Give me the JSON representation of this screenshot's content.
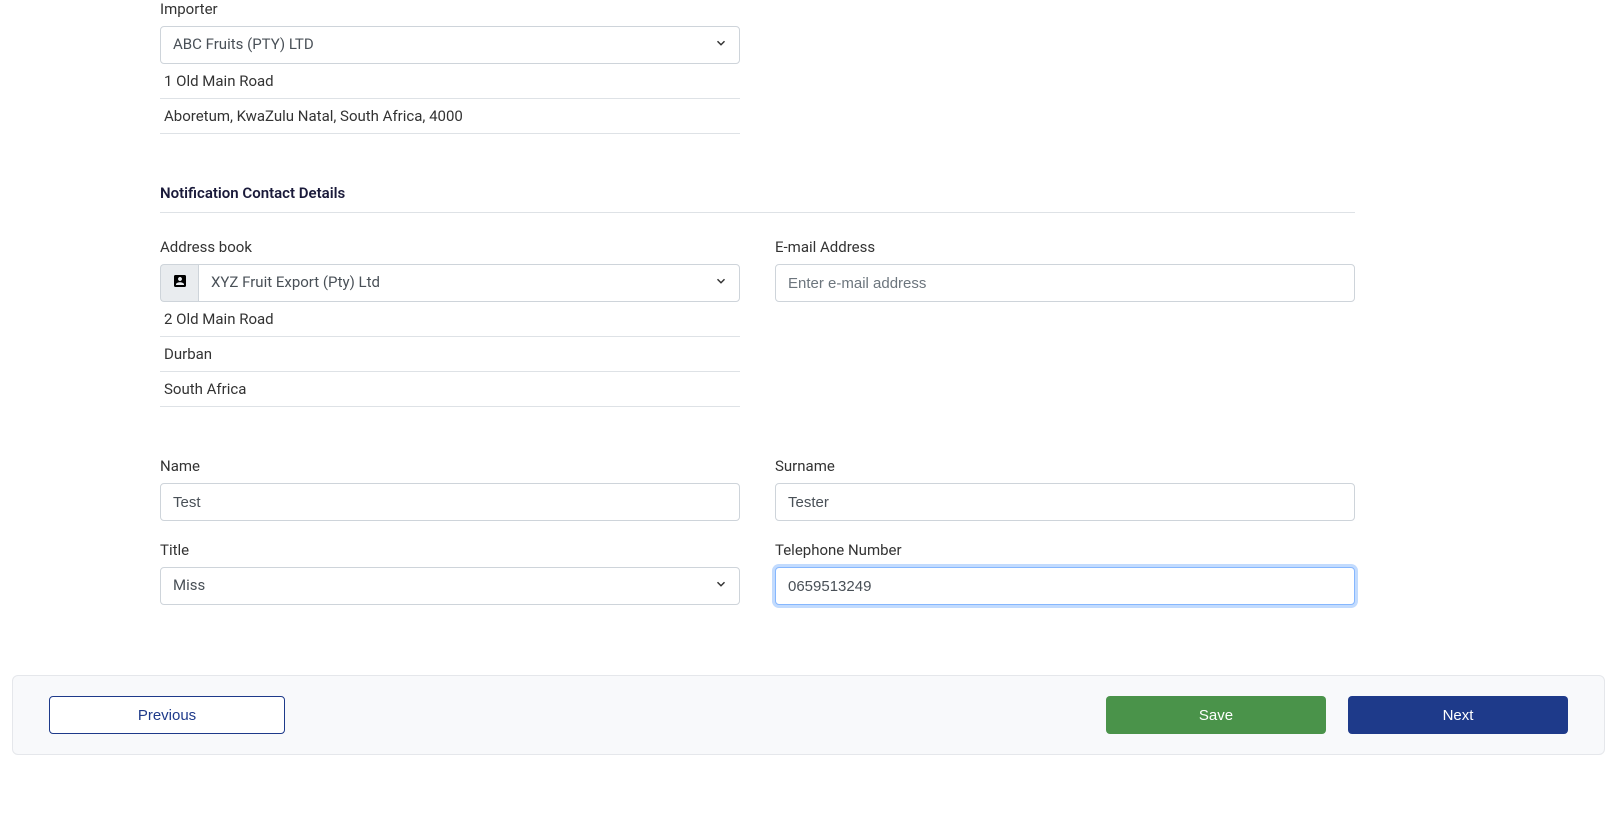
{
  "importer": {
    "label": "Importer",
    "selected": "ABC Fruits (PTY) LTD",
    "address_line1": "1 Old Main Road",
    "address_line2": "Aboretum, KwaZulu Natal, South Africa, 4000"
  },
  "notification": {
    "section_title": "Notification Contact Details",
    "address_book": {
      "label": "Address book",
      "selected": "XYZ Fruit Export (Pty) Ltd",
      "line1": "2 Old Main Road",
      "line2": "Durban",
      "line3": "South Africa"
    },
    "email": {
      "label": "E-mail Address",
      "placeholder": "Enter e-mail address",
      "value": ""
    },
    "name": {
      "label": "Name",
      "value": "Test"
    },
    "surname": {
      "label": "Surname",
      "value": "Tester"
    },
    "title": {
      "label": "Title",
      "selected": "Miss"
    },
    "telephone": {
      "label": "Telephone Number",
      "value": "0659513249"
    }
  },
  "footer": {
    "previous": "Previous",
    "save": "Save",
    "next": "Next"
  }
}
